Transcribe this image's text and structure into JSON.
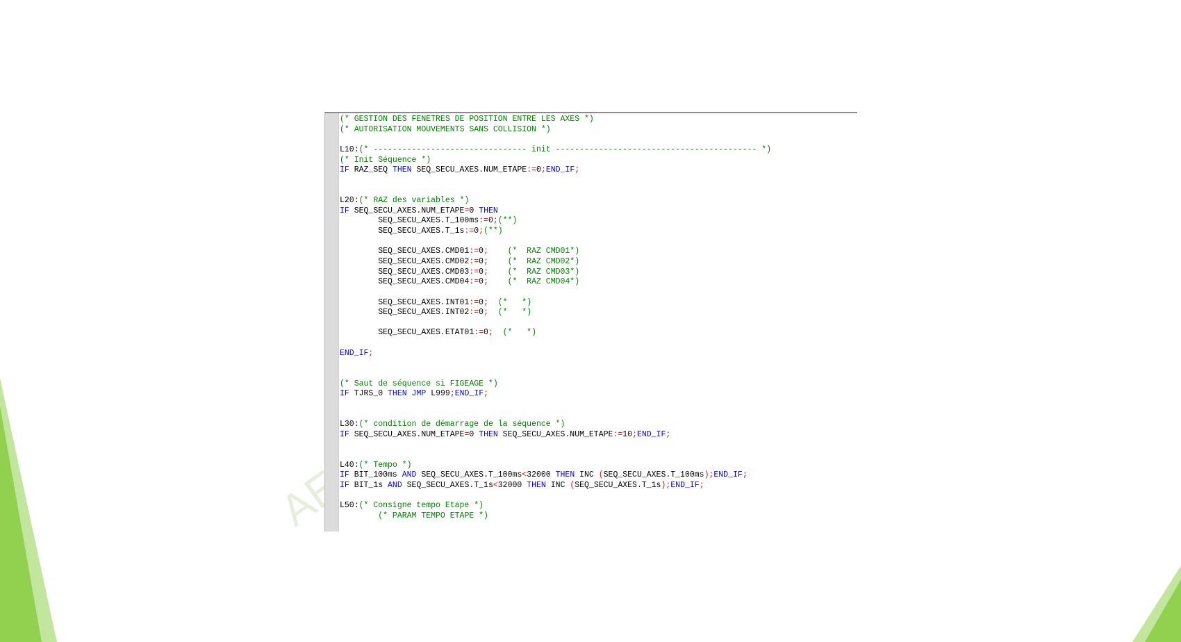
{
  "colors": {
    "keyword": "#0000ff",
    "comment": "#008000",
    "operator": "#ff0000",
    "identifier": "#000000",
    "gutter": "#dcdcdc",
    "slide_accent_green": "#8fd14f"
  },
  "watermark": "AE",
  "code_lines": [
    [
      [
        "cm",
        "(* GESTION DES FENETRES DE POSITION ENTRE LES AXES *)"
      ]
    ],
    [
      [
        "cm",
        "(* AUTORISATION MOUVEMENTS SANS COLLISION *)"
      ]
    ],
    [],
    [
      [
        "id",
        "L10:"
      ],
      [
        "cm",
        "(* -------------------------------- init ------------------------------------------ *)"
      ]
    ],
    [
      [
        "cm",
        "(* Init Séquence *)"
      ]
    ],
    [
      [
        "kw",
        "IF"
      ],
      [
        "id",
        " RAZ_SEQ "
      ],
      [
        "kw",
        "THEN"
      ],
      [
        "id",
        " SEQ_SECU_AXES.NUM_ETAPE"
      ],
      [
        "op",
        ":="
      ],
      [
        "id",
        "0"
      ],
      [
        "op",
        ";"
      ],
      [
        "kw",
        "END_IF"
      ],
      [
        "op",
        ";"
      ]
    ],
    [],
    [],
    [
      [
        "id",
        "L20:"
      ],
      [
        "cm",
        "(* RAZ des variables *)"
      ]
    ],
    [
      [
        "kw",
        "IF"
      ],
      [
        "id",
        " SEQ_SECU_AXES.NUM_ETAPE"
      ],
      [
        "op",
        "="
      ],
      [
        "id",
        "0 "
      ],
      [
        "kw",
        "THEN"
      ]
    ],
    [
      [
        "id",
        "        SEQ_SECU_AXES.T_100ms"
      ],
      [
        "op",
        ":="
      ],
      [
        "id",
        "0"
      ],
      [
        "op",
        ";"
      ],
      [
        "cm",
        "(**)"
      ]
    ],
    [
      [
        "id",
        "        SEQ_SECU_AXES.T_1s"
      ],
      [
        "op",
        ":="
      ],
      [
        "id",
        "0"
      ],
      [
        "op",
        ";"
      ],
      [
        "cm",
        "(**)"
      ]
    ],
    [],
    [
      [
        "id",
        "        SEQ_SECU_AXES.CMD01"
      ],
      [
        "op",
        ":="
      ],
      [
        "id",
        "0"
      ],
      [
        "op",
        ";"
      ],
      [
        "id",
        "    "
      ],
      [
        "cm",
        "(*  RAZ CMD01*)"
      ]
    ],
    [
      [
        "id",
        "        SEQ_SECU_AXES.CMD02"
      ],
      [
        "op",
        ":="
      ],
      [
        "id",
        "0"
      ],
      [
        "op",
        ";"
      ],
      [
        "id",
        "    "
      ],
      [
        "cm",
        "(*  RAZ CMD02*)"
      ]
    ],
    [
      [
        "id",
        "        SEQ_SECU_AXES.CMD03"
      ],
      [
        "op",
        ":="
      ],
      [
        "id",
        "0"
      ],
      [
        "op",
        ";"
      ],
      [
        "id",
        "    "
      ],
      [
        "cm",
        "(*  RAZ CMD03*)"
      ]
    ],
    [
      [
        "id",
        "        SEQ_SECU_AXES.CMD04"
      ],
      [
        "op",
        ":="
      ],
      [
        "id",
        "0"
      ],
      [
        "op",
        ";"
      ],
      [
        "id",
        "    "
      ],
      [
        "cm",
        "(*  RAZ CMD04*)"
      ]
    ],
    [],
    [
      [
        "id",
        "        SEQ_SECU_AXES.INT01"
      ],
      [
        "op",
        ":="
      ],
      [
        "id",
        "0"
      ],
      [
        "op",
        ";"
      ],
      [
        "id",
        "  "
      ],
      [
        "cm",
        "(*   *)"
      ]
    ],
    [
      [
        "id",
        "        SEQ_SECU_AXES.INT02"
      ],
      [
        "op",
        ":="
      ],
      [
        "id",
        "0"
      ],
      [
        "op",
        ";"
      ],
      [
        "id",
        "  "
      ],
      [
        "cm",
        "(*   *)"
      ]
    ],
    [],
    [
      [
        "id",
        "        SEQ_SECU_AXES.ETAT01"
      ],
      [
        "op",
        ":="
      ],
      [
        "id",
        "0"
      ],
      [
        "op",
        ";"
      ],
      [
        "id",
        "  "
      ],
      [
        "cm",
        "(*   *)"
      ]
    ],
    [],
    [
      [
        "kw",
        "END_IF"
      ],
      [
        "op",
        ";"
      ]
    ],
    [],
    [],
    [
      [
        "cm",
        "(* Saut de séquence si FIGEAGE *)"
      ]
    ],
    [
      [
        "kw",
        "IF"
      ],
      [
        "id",
        " TJRS_0 "
      ],
      [
        "kw",
        "THEN"
      ],
      [
        "id",
        " "
      ],
      [
        "kw",
        "JMP"
      ],
      [
        "id",
        " L999"
      ],
      [
        "op",
        ";"
      ],
      [
        "kw",
        "END_IF"
      ],
      [
        "op",
        ";"
      ]
    ],
    [],
    [],
    [
      [
        "id",
        "L30:"
      ],
      [
        "cm",
        "(* condition de démarrage de la séquence *)"
      ]
    ],
    [
      [
        "kw",
        "IF"
      ],
      [
        "id",
        " SEQ_SECU_AXES.NUM_ETAPE"
      ],
      [
        "op",
        "="
      ],
      [
        "id",
        "0 "
      ],
      [
        "kw",
        "THEN"
      ],
      [
        "id",
        " SEQ_SECU_AXES.NUM_ETAPE"
      ],
      [
        "op",
        ":="
      ],
      [
        "id",
        "10"
      ],
      [
        "op",
        ";"
      ],
      [
        "kw",
        "END_IF"
      ],
      [
        "op",
        ";"
      ]
    ],
    [],
    [],
    [
      [
        "id",
        "L40:"
      ],
      [
        "cm",
        "(* Tempo *)"
      ]
    ],
    [
      [
        "kw",
        "IF"
      ],
      [
        "id",
        " BIT_100ms "
      ],
      [
        "kw",
        "AND"
      ],
      [
        "id",
        " SEQ_SECU_AXES.T_100ms"
      ],
      [
        "op",
        "<"
      ],
      [
        "id",
        "32000 "
      ],
      [
        "kw",
        "THEN"
      ],
      [
        "id",
        " INC "
      ],
      [
        "op",
        "("
      ],
      [
        "id",
        "SEQ_SECU_AXES.T_100ms"
      ],
      [
        "op",
        ");"
      ],
      [
        "kw",
        "END_IF"
      ],
      [
        "op",
        ";"
      ]
    ],
    [
      [
        "kw",
        "IF"
      ],
      [
        "id",
        " BIT_1s "
      ],
      [
        "kw",
        "AND"
      ],
      [
        "id",
        " SEQ_SECU_AXES.T_1s"
      ],
      [
        "op",
        "<"
      ],
      [
        "id",
        "32000 "
      ],
      [
        "kw",
        "THEN"
      ],
      [
        "id",
        " INC "
      ],
      [
        "op",
        "("
      ],
      [
        "id",
        "SEQ_SECU_AXES.T_1s"
      ],
      [
        "op",
        ");"
      ],
      [
        "kw",
        "END_IF"
      ],
      [
        "op",
        ";"
      ]
    ],
    [],
    [
      [
        "id",
        "L50:"
      ],
      [
        "cm",
        "(* Consigne tempo Etape *)"
      ]
    ],
    [
      [
        "id",
        "        "
      ],
      [
        "cm",
        "(* PARAM TEMPO ETAPE *)"
      ]
    ]
  ]
}
